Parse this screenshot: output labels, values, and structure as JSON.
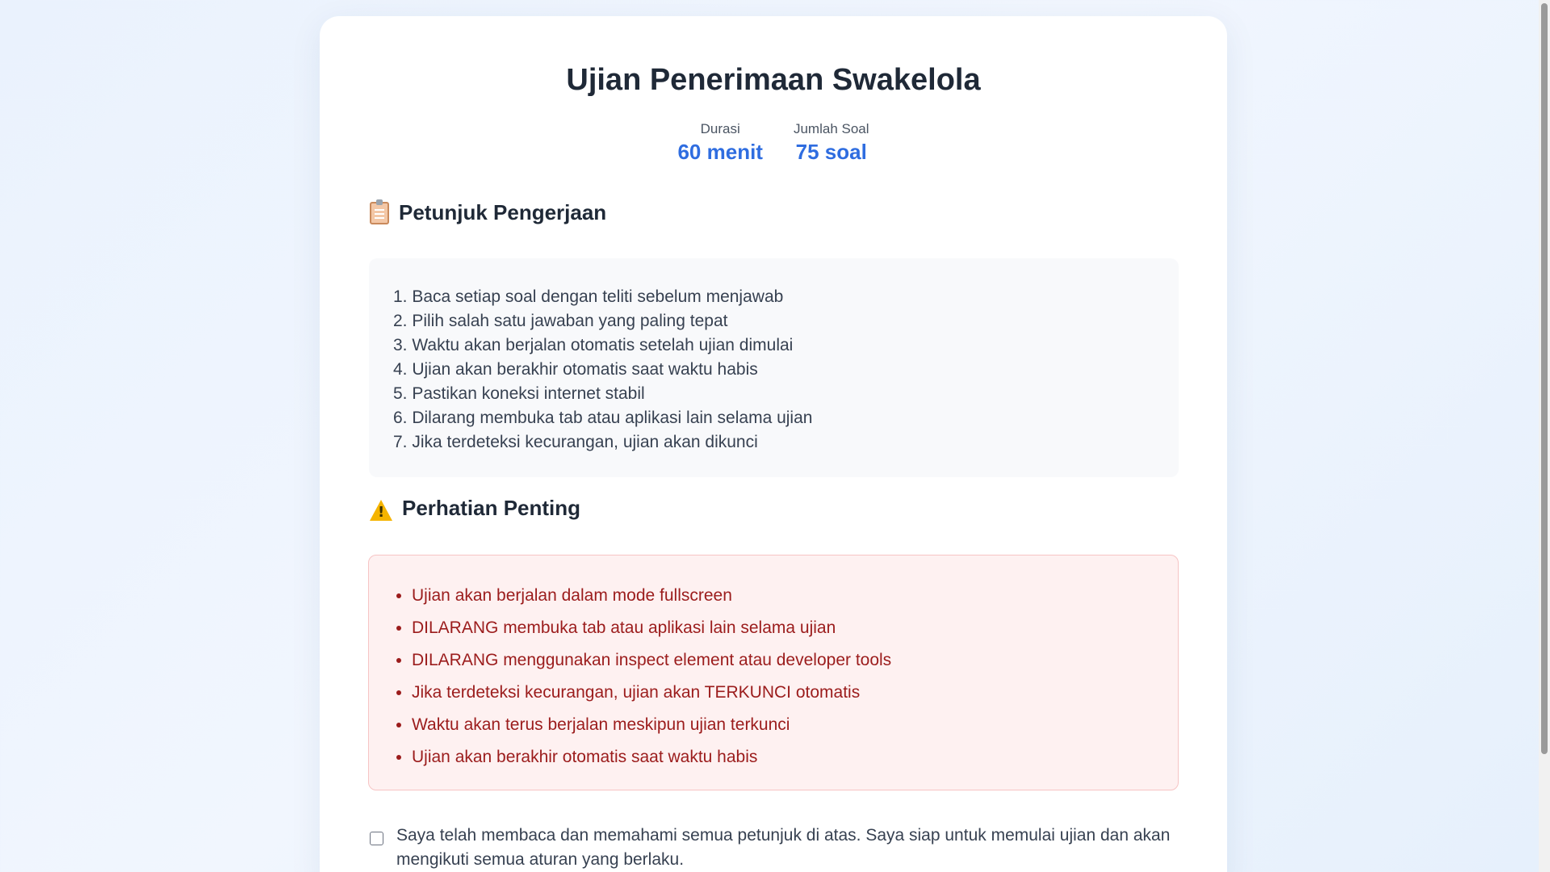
{
  "header": {
    "title": "Ujian Penerimaan Swakelola"
  },
  "stats": [
    {
      "label": "Durasi",
      "value": "60 menit"
    },
    {
      "label": "Jumlah Soal",
      "value": "75 soal"
    }
  ],
  "instructions": {
    "title": "Petunjuk Pengerjaan",
    "icon": "clipboard-icon",
    "items": [
      "1. Baca setiap soal dengan teliti sebelum menjawab",
      "2. Pilih salah satu jawaban yang paling tepat",
      "3. Waktu akan berjalan otomatis setelah ujian dimulai",
      "4. Ujian akan berakhir otomatis saat waktu habis",
      "5. Pastikan koneksi internet stabil",
      "6. Dilarang membuka tab atau aplikasi lain selama ujian",
      "7. Jika terdeteksi kecurangan, ujian akan dikunci"
    ]
  },
  "warnings": {
    "title": "Perhatian Penting",
    "icon": "warning-icon",
    "items": [
      "Ujian akan berjalan dalam mode fullscreen",
      "DILARANG membuka tab atau aplikasi lain selama ujian",
      "DILARANG menggunakan inspect element atau developer tools",
      "Jika terdeteksi kecurangan, ujian akan TERKUNCI otomatis",
      "Waktu akan terus berjalan meskipun ujian terkunci",
      "Ujian akan berakhir otomatis saat waktu habis"
    ]
  },
  "agreement": {
    "checked": false,
    "text": "Saya telah membaca dan memahami semua petunjuk di atas. Saya siap untuk memulai ujian dan akan mengikuti semua aturan yang berlaku."
  },
  "colors": {
    "accent": "#2f6de0",
    "warning_text": "#9b1c1c",
    "warning_bg": "#fef1f1"
  }
}
